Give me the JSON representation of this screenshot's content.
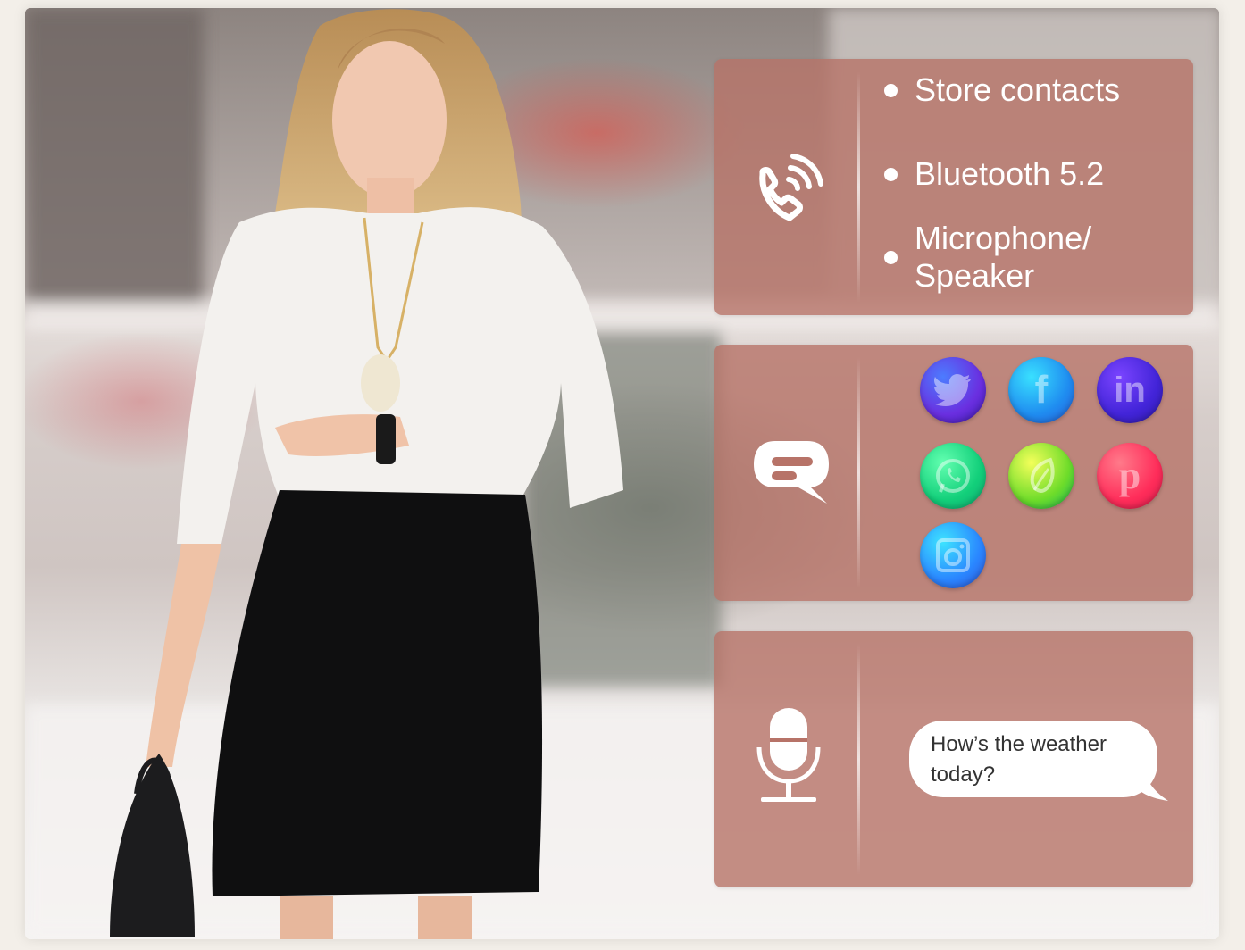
{
  "scene": {
    "image_alt": "Woman checking smartwatch",
    "panel_color": "#b77368"
  },
  "panels": [
    {
      "icon": "phone-call-icon",
      "bullets": [
        "Store contacts",
        "Bluetooth 5.2",
        "Microphone/\nSpeaker"
      ]
    },
    {
      "icon": "chat-bubble-icon",
      "social_icons": [
        "twitter-icon",
        "facebook-icon",
        "linkedin-icon",
        "whatsapp-icon",
        "evernote-icon",
        "pinterest-icon",
        "instagram-icon"
      ]
    },
    {
      "icon": "microphone-icon",
      "speech_text": "How’s the weather\ntoday?"
    }
  ]
}
